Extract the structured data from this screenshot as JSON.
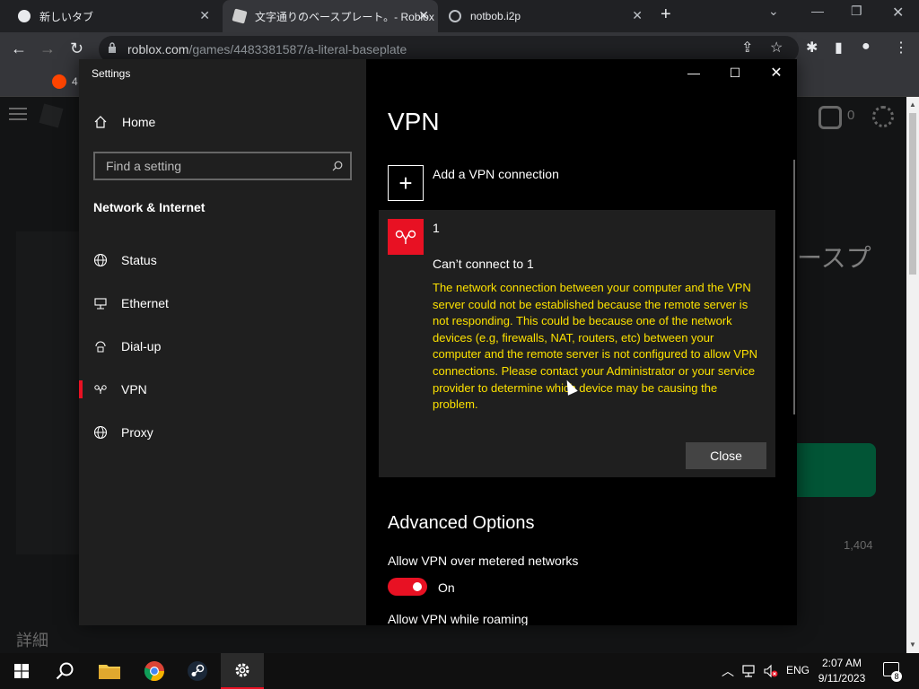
{
  "browser": {
    "tabs": [
      {
        "title": "新しいタブ"
      },
      {
        "title": "文字通りのベースプレート。- Roblox"
      },
      {
        "title": "notbob.i2p"
      }
    ],
    "url_host": "roblox.com",
    "url_path": "/games/4483381587/a-literal-baseplate",
    "bookmark_badge": "4"
  },
  "page": {
    "title_partial": "ースプ",
    "robux": "0",
    "count": "1,404",
    "details": "詳細"
  },
  "settings": {
    "window_title": "Settings",
    "home_label": "Home",
    "search_placeholder": "Find a setting",
    "section_heading": "Network & Internet",
    "nav": [
      {
        "label": "Status",
        "icon": "globe-icon"
      },
      {
        "label": "Ethernet",
        "icon": "ethernet-icon"
      },
      {
        "label": "Dial-up",
        "icon": "dialup-icon"
      },
      {
        "label": "VPN",
        "icon": "vpn-icon"
      },
      {
        "label": "Proxy",
        "icon": "globe-icon"
      }
    ],
    "page_title": "VPN",
    "add_vpn_label": "Add a VPN connection",
    "connection": {
      "name": "1",
      "error_title": "Can’t connect to 1",
      "error_detail": "The network connection between your computer and the VPN server could not be established because the remote server is not responding. This could be because one of the network devices (e.g, firewalls, NAT, routers, etc) between your computer and the remote server is not configured to allow VPN connections. Please contact your Administrator or your service provider to determine which device may be causing the problem.",
      "close_label": "Close"
    },
    "advanced_heading": "Advanced Options",
    "option_metered": "Allow VPN over metered networks",
    "toggle_state": "On",
    "option_roaming": "Allow VPN while roaming"
  },
  "taskbar": {
    "language": "ENG",
    "time": "2:07 AM",
    "date": "9/11/2023",
    "notifications": "8"
  },
  "colors": {
    "accent": "#e81123",
    "error_text": "#fce100"
  }
}
